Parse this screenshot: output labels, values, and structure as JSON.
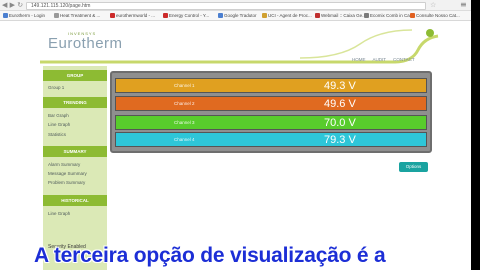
{
  "browser": {
    "url": "149.121.115.120/page.htm",
    "bookmarks": [
      {
        "label": "Eurotherm - Login",
        "color": "#4b7fd0"
      },
      {
        "label": "Heat Treatment & ...",
        "color": "#999999"
      },
      {
        "label": "eurothermworld - ...",
        "color": "#cc2a2a"
      },
      {
        "label": "Energy Control - Y...",
        "color": "#cc2a2a"
      },
      {
        "label": "Google Tradutor",
        "color": "#4b7fd0"
      },
      {
        "label": "UCI - Agent de Proc...",
        "color": "#d0a030"
      },
      {
        "label": "Webmail :: Caixa Ge...",
        "color": "#c03030"
      },
      {
        "label": "Ecomix Comb in Ca...",
        "color": "#7a7a7a"
      },
      {
        "label": "Consulte Nosso Cat...",
        "color": "#e06020"
      }
    ]
  },
  "header": {
    "brand_small": "INVENSYS",
    "brand": "Eurotherm",
    "top_links": "HOME  AUDIT  CONTACT"
  },
  "sidebar": {
    "sections": [
      {
        "heading": "GROUP",
        "items": [
          "Group 1"
        ]
      },
      {
        "heading": "TRENDING",
        "items": [
          "Bar Graph",
          "Line Graph",
          "Statistics"
        ]
      },
      {
        "heading": "SUMMARY",
        "items": [
          "Alarm Summary",
          "Message Summary",
          "Problem Summary"
        ]
      },
      {
        "heading": "HISTORICAL",
        "items": [
          "Line Graph"
        ]
      }
    ],
    "status": "Security Enabled"
  },
  "channels": [
    {
      "label": "Channel 1",
      "value": "49.3 V",
      "color": "#e0a020"
    },
    {
      "label": "Channel 2",
      "value": "49.6 V",
      "color": "#e06a20"
    },
    {
      "label": "Channel 3",
      "value": "70.0 V",
      "color": "#58cc2c"
    },
    {
      "label": "Channel 4",
      "value": "79.3 V",
      "color": "#2ec6d8"
    }
  ],
  "options_label": "Options",
  "caption": "A terceira opção de visualização é a"
}
